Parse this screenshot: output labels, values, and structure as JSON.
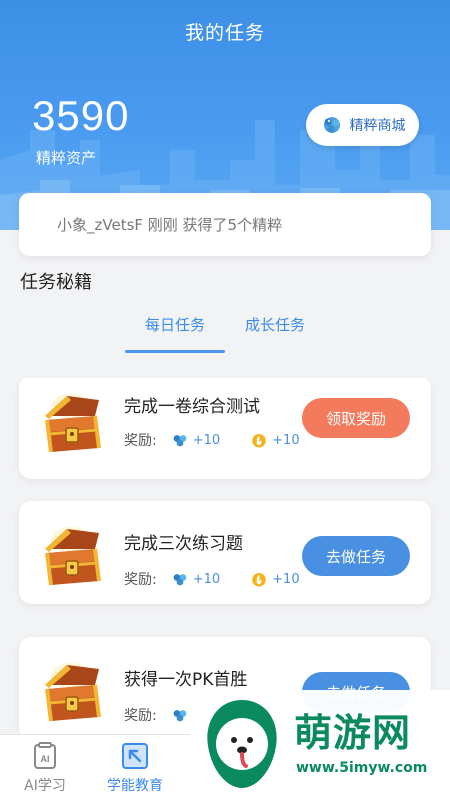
{
  "header": {
    "title": "我的任务",
    "assets_value": "3590",
    "assets_label": "精粹资产",
    "shop_button_label": "精粹商城"
  },
  "notice": {
    "text": "小象_zVetsF 刚刚 获得了5个精粹"
  },
  "section": {
    "title": "任务秘籍"
  },
  "tabs": [
    {
      "label": "每日任务",
      "active": true
    },
    {
      "label": "成长任务",
      "active": false
    }
  ],
  "tasks": [
    {
      "title": "完成一卷综合测试",
      "reward_label": "奖励:",
      "reward_essence": "+10",
      "reward_points": "+10",
      "button_label": "领取奖励",
      "button_color": "#f37a5c"
    },
    {
      "title": "完成三次练习题",
      "reward_label": "奖励:",
      "reward_essence": "+10",
      "reward_points": "+10",
      "button_label": "去做任务",
      "button_color": "#4a90e2"
    },
    {
      "title": "获得一次PK首胜",
      "reward_label": "奖励:",
      "reward_essence": "",
      "reward_points": "",
      "button_label": "去做任务",
      "button_color": "#4a90e2"
    }
  ],
  "bottom_nav": [
    {
      "label": "AI学习",
      "icon": "ai-book-icon",
      "active": false
    },
    {
      "label": "学能教育",
      "icon": "arrow-box-icon",
      "active": true
    }
  ],
  "watermark": {
    "title": "萌游网",
    "url": "www.5imyw.com"
  },
  "colors": {
    "primary_blue": "#4a90e2",
    "header_blue": "#3d8fe6",
    "claim_orange": "#f37a5c"
  }
}
